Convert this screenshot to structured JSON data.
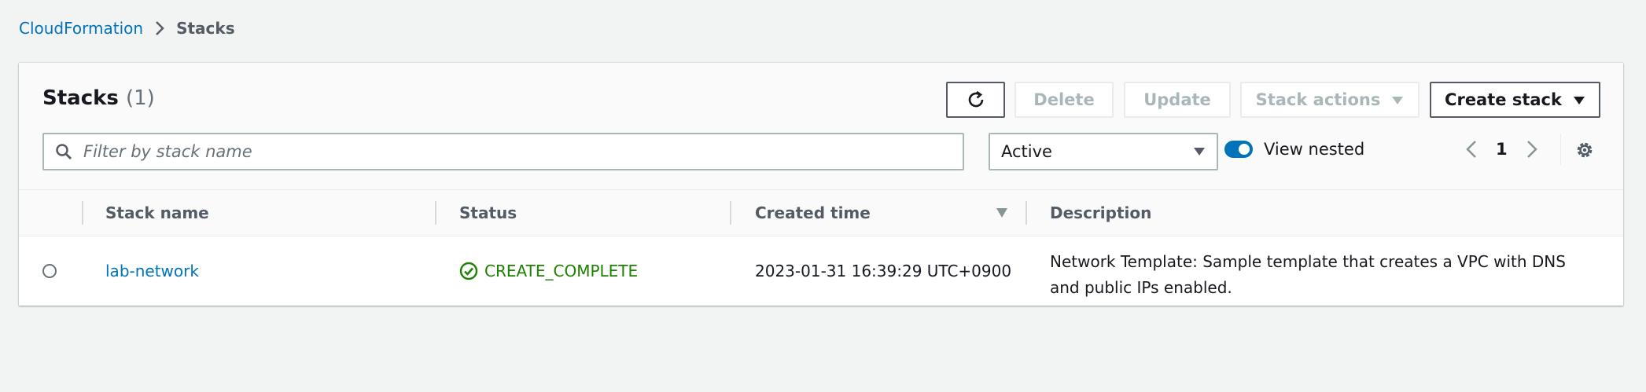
{
  "breadcrumb": {
    "root": "CloudFormation",
    "current": "Stacks"
  },
  "panel": {
    "title": "Stacks",
    "count": "(1)"
  },
  "toolbar": {
    "refresh_icon": "refresh-icon",
    "delete_label": "Delete",
    "update_label": "Update",
    "stack_actions_label": "Stack actions",
    "create_stack_label": "Create stack"
  },
  "filter": {
    "placeholder": "Filter by stack name",
    "value": ""
  },
  "status_filter": {
    "selected": "Active"
  },
  "view_nested": {
    "label": "View nested",
    "enabled": true
  },
  "pagination": {
    "page": "1"
  },
  "table": {
    "columns": [
      "Stack name",
      "Status",
      "Created time",
      "Description"
    ],
    "sorted_column": "Created time",
    "rows": [
      {
        "stack_name": "lab-network",
        "status": "CREATE_COMPLETE",
        "created_time": "2023-01-31 16:39:29 UTC+0900",
        "description": "Network Template: Sample template that creates a VPC with DNS and public IPs enabled."
      }
    ]
  },
  "colors": {
    "link": "#0073bb",
    "success": "#1d8102",
    "background": "#f2f3f3"
  }
}
